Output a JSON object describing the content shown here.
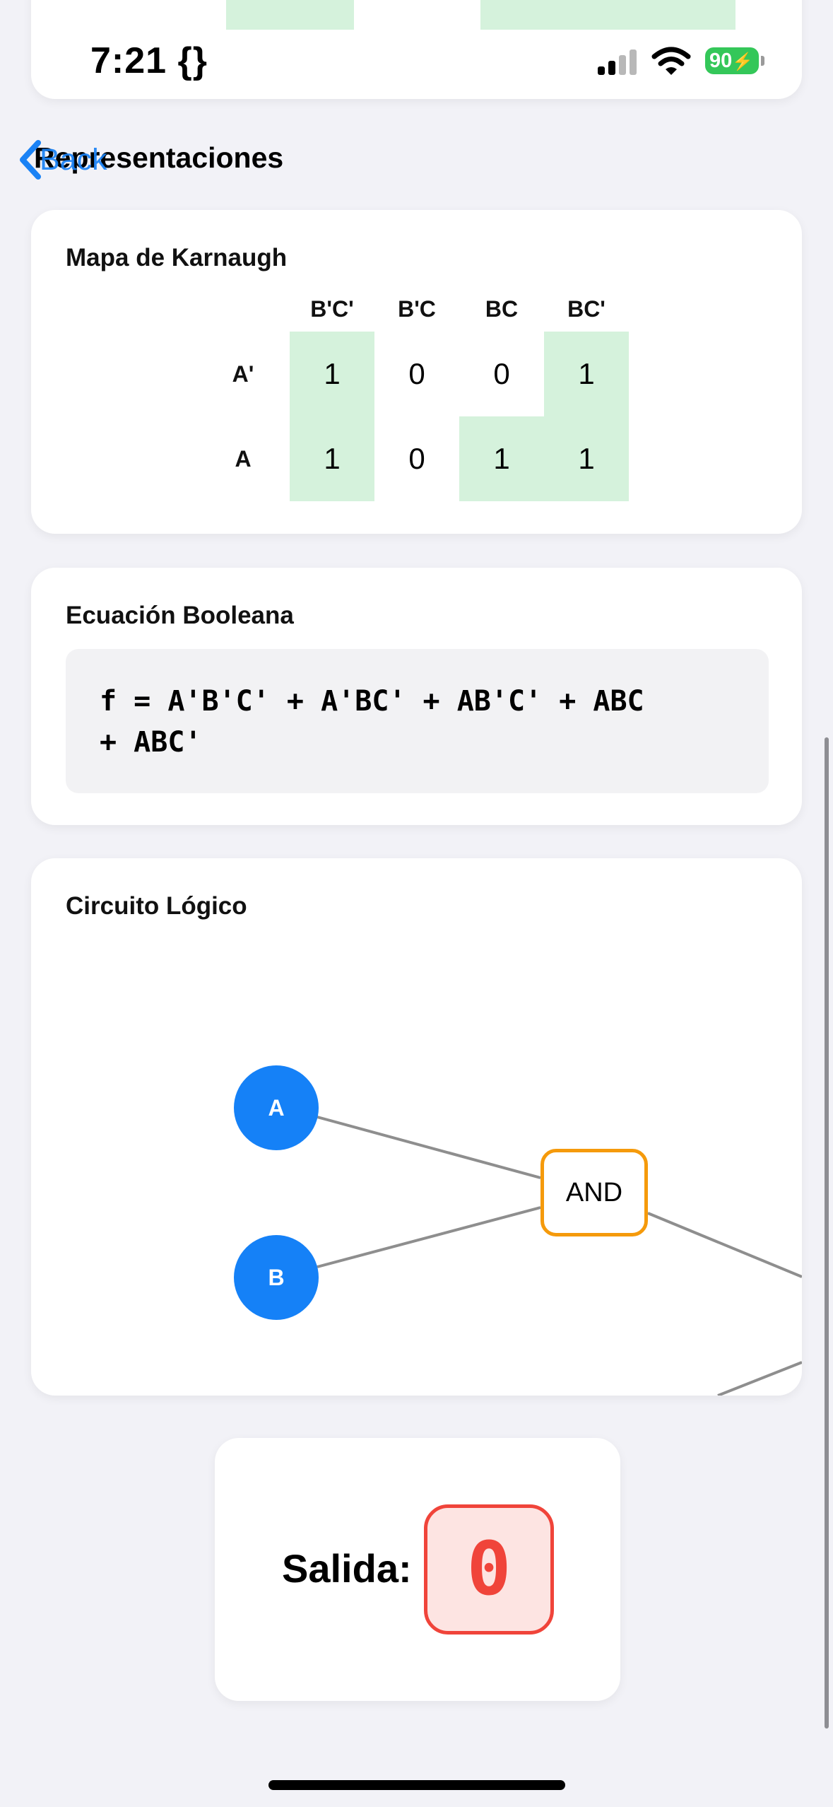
{
  "status_bar": {
    "time": "7:21",
    "focus_glyph": "{}",
    "battery": "90",
    "icons": [
      "signal-icon",
      "wifi-icon",
      "battery-charging-icon"
    ]
  },
  "nav": {
    "title": "Representaciones",
    "back_label": "Back"
  },
  "kmap": {
    "title": "Mapa de Karnaugh",
    "columns": [
      "B'C'",
      "B'C",
      "BC",
      "BC'"
    ],
    "rows": [
      {
        "label": "A'",
        "cells": [
          "1",
          "0",
          "0",
          "1"
        ]
      },
      {
        "label": "A",
        "cells": [
          "1",
          "0",
          "1",
          "1"
        ]
      }
    ],
    "highlight_color": "#d5f2dc"
  },
  "equation": {
    "title": "Ecuación Booleana",
    "text": "f = A'B'C' + A'BC' + AB'C' + ABC\n+ ABC'"
  },
  "circuit": {
    "title": "Circuito Lógico",
    "inputs": [
      "A",
      "B"
    ],
    "gate": "AND",
    "input_color": "#1581f7",
    "gate_color": "#f59a0b"
  },
  "output": {
    "label": "Salida:",
    "value": "0",
    "color": "#f0443a"
  },
  "colors": {
    "accent": "#1a82f5",
    "background": "#f2f2f7"
  }
}
